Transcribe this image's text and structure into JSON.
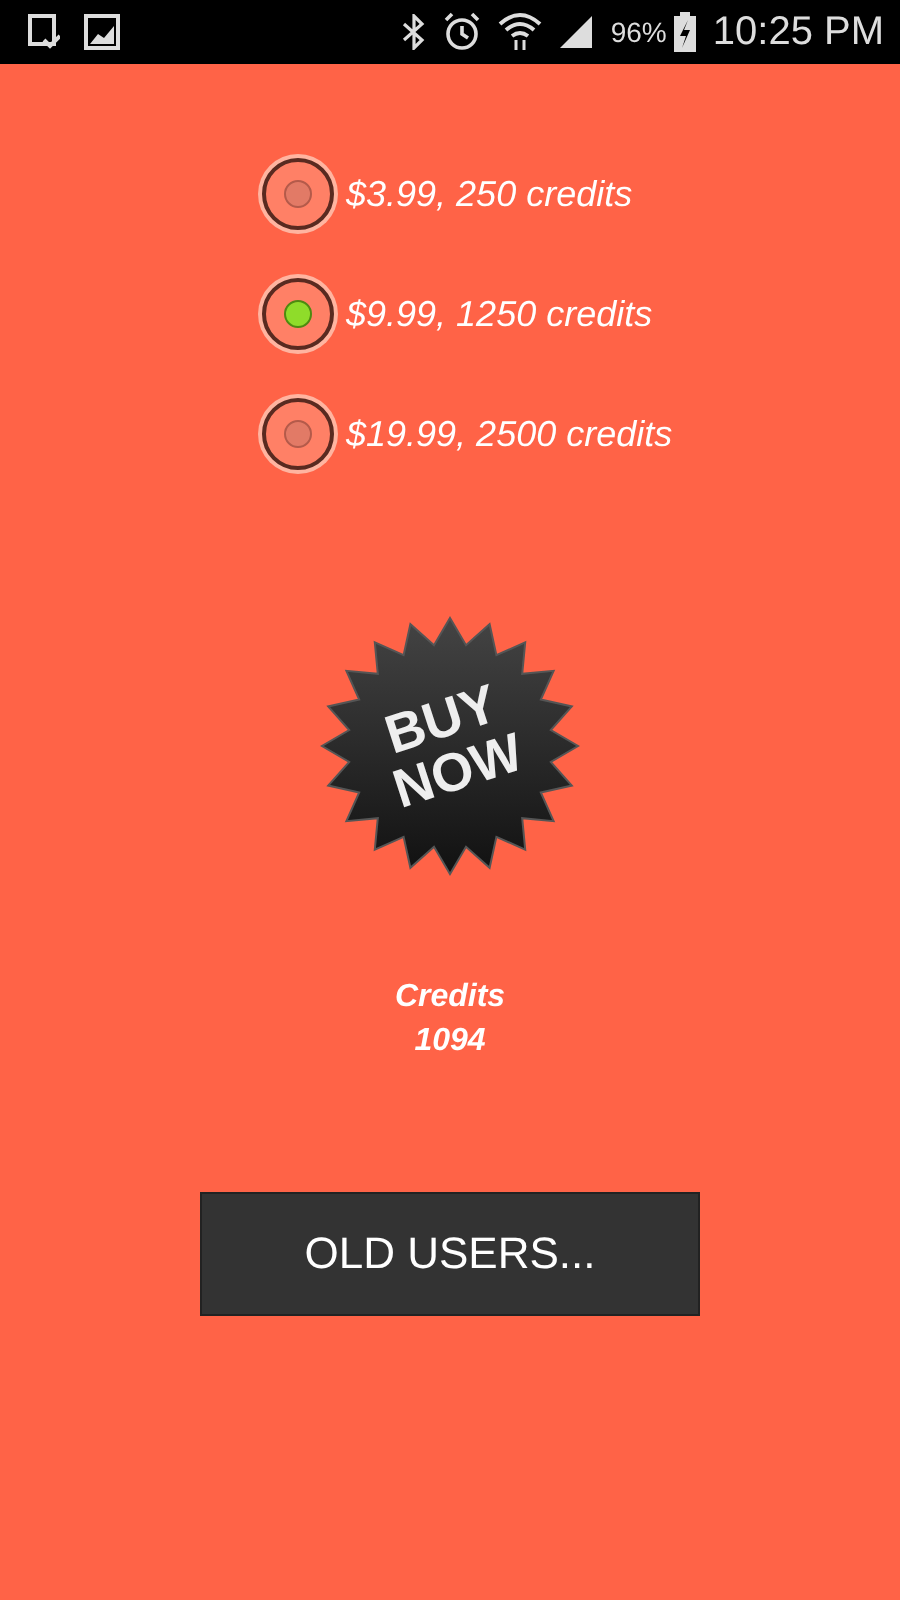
{
  "status_bar": {
    "battery": "96%",
    "time": "10:25 PM"
  },
  "options": [
    {
      "label": "$3.99, 250 credits",
      "selected": false
    },
    {
      "label": "$9.99, 1250 credits",
      "selected": true
    },
    {
      "label": "$19.99, 2500 credits",
      "selected": false
    }
  ],
  "buy_button": {
    "label_lines": [
      "BUY",
      "NOW"
    ]
  },
  "credits": {
    "label": "Credits",
    "value": "1094"
  },
  "old_users_button": {
    "label": "OLD USERS..."
  }
}
